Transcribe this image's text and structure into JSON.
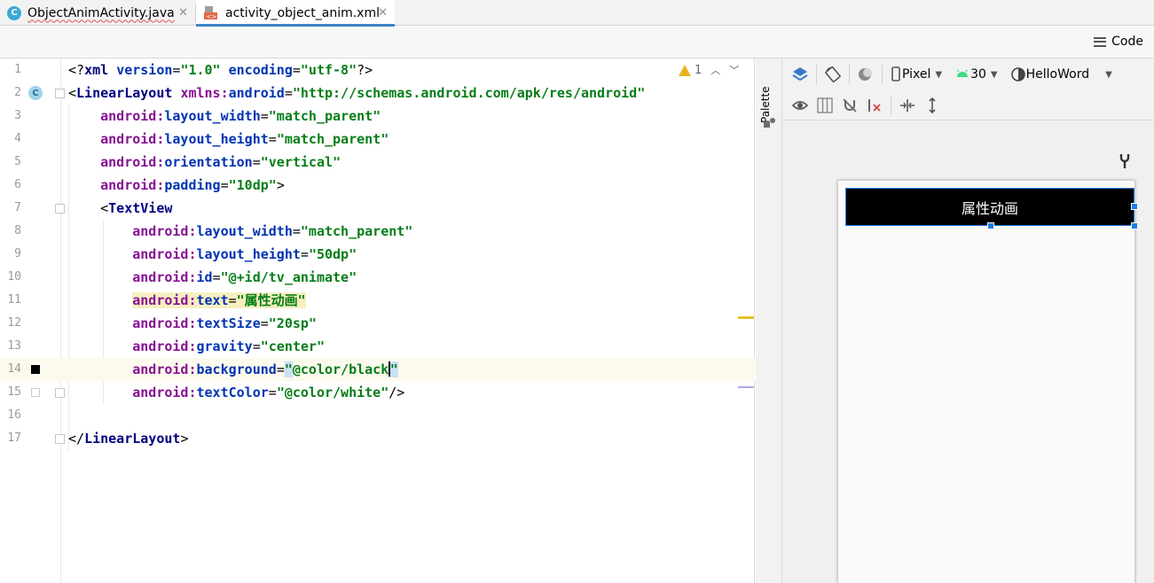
{
  "tabs": [
    {
      "label": "ObjectAnimActivity.java",
      "badge": "C"
    },
    {
      "label": "activity_object_anim.xml",
      "active": true
    }
  ],
  "toolbar": {
    "code_label": "Code"
  },
  "editor": {
    "inspection": {
      "warning_count": "1"
    },
    "lines": [
      {
        "n": "1"
      },
      {
        "n": "2"
      },
      {
        "n": "3"
      },
      {
        "n": "4"
      },
      {
        "n": "5"
      },
      {
        "n": "6"
      },
      {
        "n": "7"
      },
      {
        "n": "8"
      },
      {
        "n": "9"
      },
      {
        "n": "10"
      },
      {
        "n": "11"
      },
      {
        "n": "12"
      },
      {
        "n": "13"
      },
      {
        "n": "14"
      },
      {
        "n": "15"
      },
      {
        "n": "16"
      },
      {
        "n": "17"
      }
    ],
    "gutter_badge": "C"
  },
  "palette": {
    "label": "Palette"
  },
  "design": {
    "device": "Pixel",
    "api": "30",
    "theme": "HelloWord",
    "preview_text": "属性动画"
  },
  "colors": {
    "accent": "#4083c9",
    "selection": "#1a7ee8",
    "warning": "#e8b520"
  }
}
